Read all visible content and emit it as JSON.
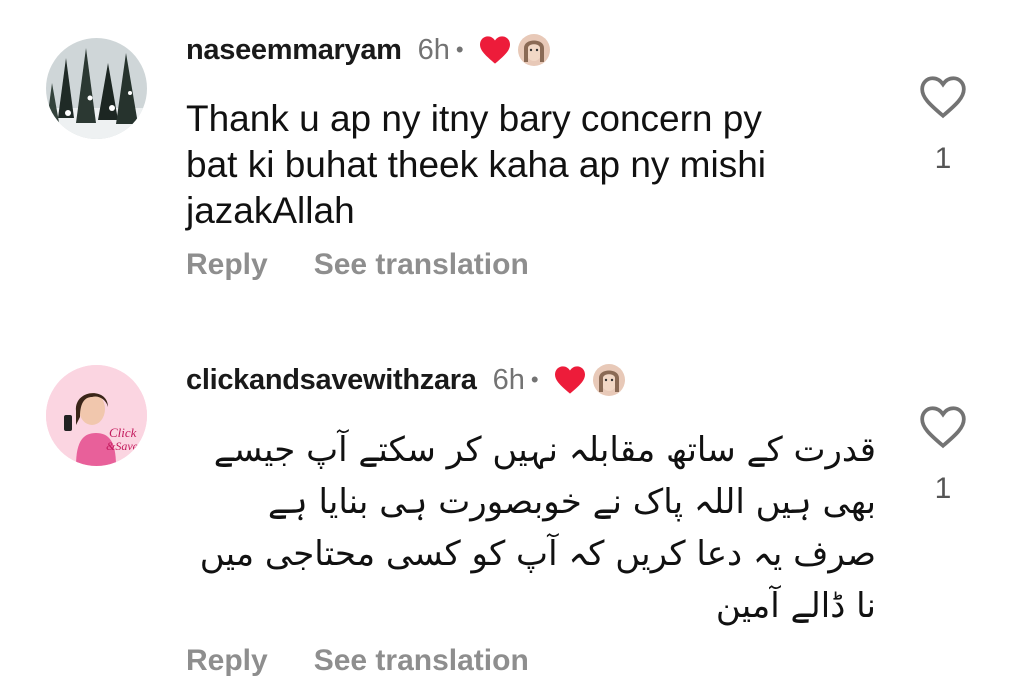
{
  "comments": [
    {
      "username": "naseemmaryam",
      "time": "6h",
      "dot": "•",
      "text_lines": [
        "Thank u ap ny itny bary concern py",
        "bat ki buhat theek kaha ap ny mishi",
        "jazakAllah"
      ],
      "reply_label": "Reply",
      "translate_label": "See translation",
      "like_count": "1",
      "avatar_icon": "snowy-forest-avatar",
      "creator_liked": true
    },
    {
      "username": "clickandsavewithzara",
      "time": "6h",
      "dot": "•",
      "text_lines": [
        "قدرت کے ساتھ مقابلہ نہیں کر سکتے آپ جیسے",
        "بھی ہیں اللہ پاک نے خوبصورت ہی بنایا ہے",
        "صرف یہ دعا کریں کہ آپ کو کسی محتاجی میں",
        "نا ڈالے آمین"
      ],
      "reply_label": "Reply",
      "translate_label": "See translation",
      "like_count": "1",
      "avatar_icon": "click-and-save-logo-avatar",
      "avatar_logo_text": [
        "Click",
        "&Save"
      ],
      "creator_liked": true
    }
  ],
  "colors": {
    "heart_red": "#ed1c3a",
    "muted": "#8e8e8e",
    "avatar2_bg": "#fbd5e1"
  }
}
